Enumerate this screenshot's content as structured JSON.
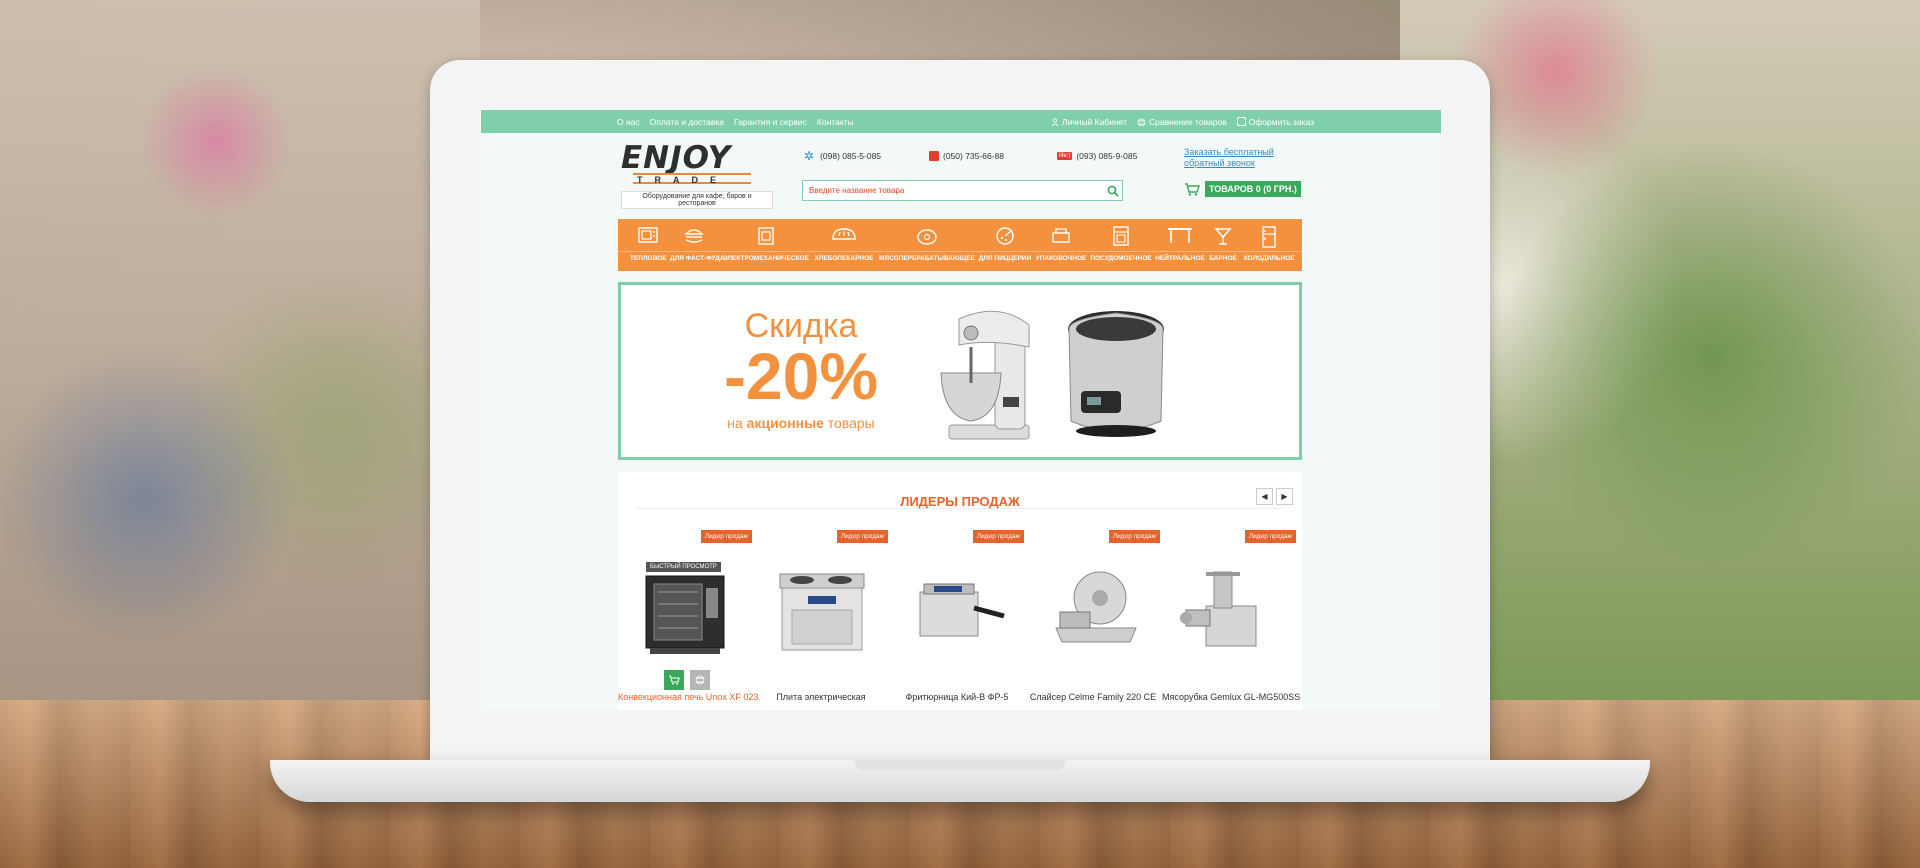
{
  "colors": {
    "accent_green": "#7fd0aa",
    "accent_orange": "#f3913f",
    "title_orange": "#e8622a",
    "cart_green": "#3aa85a"
  },
  "topbar": {
    "nav": [
      "О нас",
      "Оплата и доставка",
      "Гарантия и сервис",
      "Контакты"
    ],
    "right": [
      {
        "icon": "user-icon",
        "label": "Личный Кабинет"
      },
      {
        "icon": "compare-icon",
        "label": "Сравнение товаров"
      },
      {
        "icon": "checkout-icon",
        "label": "Оформить заказ"
      }
    ]
  },
  "logo": {
    "word1": "ENJOY",
    "word2": "TRADE",
    "tagline": "Оборудование для кафе, баров и ресторанов"
  },
  "phones": [
    {
      "operator_icon": "kyivstar-icon",
      "number": "(098) 085-5-085"
    },
    {
      "operator_icon": "mts-icon",
      "number": "(050) 735-66-88"
    },
    {
      "operator_icon": "life-icon",
      "operator_label": "life:)",
      "number": "(093) 085-9-085"
    }
  ],
  "callback": {
    "line1": "Заказать бесплатный",
    "line2": "обратный звонок"
  },
  "search": {
    "placeholder": "Введите название товара",
    "icon": "search-icon"
  },
  "cart": {
    "label": "ТОВАРОВ 0 (0 ГРН.)",
    "icon": "cart-icon"
  },
  "categories": [
    {
      "label": "ТЕПЛОВОЕ",
      "icon": "oven-icon"
    },
    {
      "label": "ДЛЯ ФАСТ-ФУДА",
      "icon": "burger-icon"
    },
    {
      "label": "ЭЛЕКТРОМЕХАНИЧЕСКОЕ",
      "icon": "mixer-icon"
    },
    {
      "label": "ХЛЕБОПЕКАРНОЕ",
      "icon": "bread-icon"
    },
    {
      "label": "МЯСОПЕРЕРАБАТЫВАЮЩЕЕ",
      "icon": "meat-icon"
    },
    {
      "label": "ДЛЯ ПИЦЦЕРИИ",
      "icon": "pizza-icon"
    },
    {
      "label": "УПАКОВОЧНОЕ",
      "icon": "packing-icon"
    },
    {
      "label": "ПОСУДОМОЕЧНОЕ",
      "icon": "dishwasher-icon"
    },
    {
      "label": "НЕЙТРАЛЬНОЕ",
      "icon": "table-icon"
    },
    {
      "label": "БАРНОЕ",
      "icon": "cocktail-icon"
    },
    {
      "label": "ХОЛОДИЛЬНОЕ",
      "icon": "fridge-icon"
    }
  ],
  "banner": {
    "title": "Скидка",
    "percent": "-20%",
    "sub_pre": "на",
    "sub_bold": "акционные",
    "sub_post": "товары"
  },
  "leaders": {
    "title": "ЛИДЕРЫ ПРОДАЖ",
    "badge": "Лидер продаж",
    "quick_view": "БЫСТРЫЙ ПРОСМОТР",
    "products": [
      {
        "name": "Конвекционная печь Unox XF 023"
      },
      {
        "name": "Плита электрическая"
      },
      {
        "name": "Фритюрница Кий-В ФР-5"
      },
      {
        "name": "Слайсер Celme Family 220 CE"
      },
      {
        "name": "Мясорубка Gemlux GL-MG500SS"
      }
    ]
  }
}
